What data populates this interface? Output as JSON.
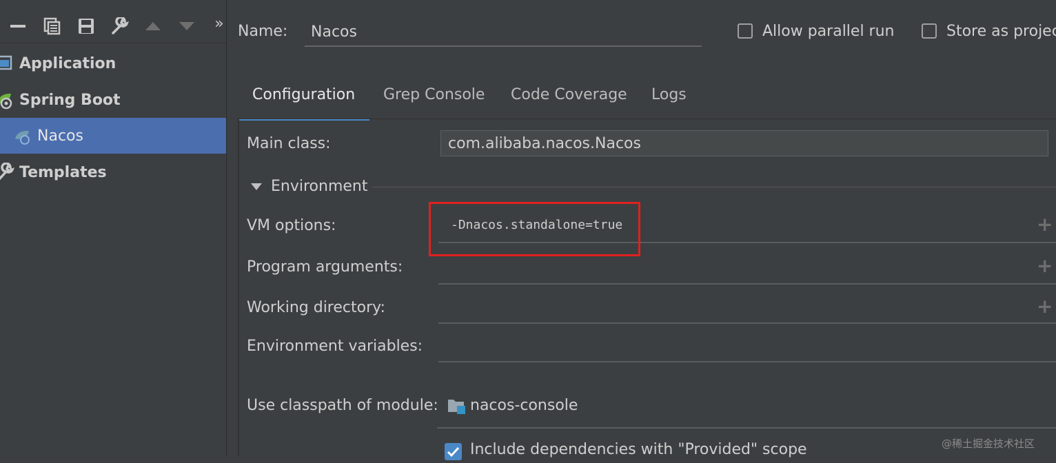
{
  "toolbar": {
    "icons": [
      "minus-icon",
      "copy-icon",
      "save-icon",
      "wrench-icon",
      "arrow-up-icon",
      "arrow-down-icon",
      "more-icon"
    ],
    "more_label": "»"
  },
  "tree": {
    "items": [
      {
        "label": "Application",
        "icon": "application-icon"
      },
      {
        "label": "Spring Boot",
        "icon": "spring-boot-icon"
      },
      {
        "label": "Nacos",
        "icon": "spring-boot-icon",
        "selected": true
      },
      {
        "label": "Templates",
        "icon": "wrench-icon"
      }
    ]
  },
  "header": {
    "name_label": "Name:",
    "name_value": "Nacos",
    "allow_parallel_label": "Allow parallel run",
    "allow_parallel_checked": false,
    "store_project_label": "Store as project",
    "store_project_checked": false
  },
  "tabs": [
    {
      "label": "Configuration",
      "active": true
    },
    {
      "label": "Grep Console",
      "active": false
    },
    {
      "label": "Code Coverage",
      "active": false
    },
    {
      "label": "Logs",
      "active": false
    }
  ],
  "config": {
    "main_class_label": "Main class:",
    "main_class_value": "com.alibaba.nacos.Nacos",
    "environment_label": "Environment",
    "vm_options_label": "VM options:",
    "vm_options_value": "-Dnacos.standalone=true",
    "program_args_label": "Program arguments:",
    "program_args_value": "",
    "working_dir_label": "Working directory:",
    "working_dir_value": "",
    "env_vars_label": "Environment variables:",
    "env_vars_value": "",
    "classpath_label": "Use classpath of module:",
    "classpath_value": "nacos-console",
    "include_provided_label": "Include dependencies with \"Provided\" scope",
    "include_provided_checked": true
  },
  "colors": {
    "background": "#3c3f41",
    "selection": "#4b6eaf",
    "accent": "#4a88c7",
    "highlight_box": "#e02020"
  },
  "watermark": "@稀土掘金技术社区"
}
